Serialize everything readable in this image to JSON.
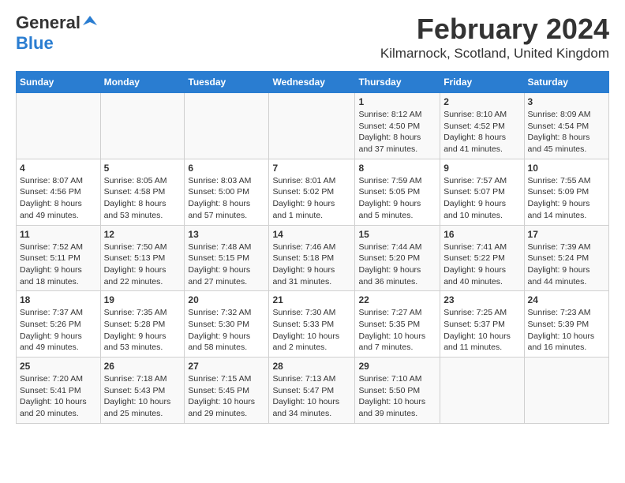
{
  "logo": {
    "general": "General",
    "blue": "Blue"
  },
  "title": "February 2024",
  "subtitle": "Kilmarnock, Scotland, United Kingdom",
  "headers": [
    "Sunday",
    "Monday",
    "Tuesday",
    "Wednesday",
    "Thursday",
    "Friday",
    "Saturday"
  ],
  "weeks": [
    [
      {
        "day": "",
        "info": ""
      },
      {
        "day": "",
        "info": ""
      },
      {
        "day": "",
        "info": ""
      },
      {
        "day": "",
        "info": ""
      },
      {
        "day": "1",
        "info": "Sunrise: 8:12 AM\nSunset: 4:50 PM\nDaylight: 8 hours\nand 37 minutes."
      },
      {
        "day": "2",
        "info": "Sunrise: 8:10 AM\nSunset: 4:52 PM\nDaylight: 8 hours\nand 41 minutes."
      },
      {
        "day": "3",
        "info": "Sunrise: 8:09 AM\nSunset: 4:54 PM\nDaylight: 8 hours\nand 45 minutes."
      }
    ],
    [
      {
        "day": "4",
        "info": "Sunrise: 8:07 AM\nSunset: 4:56 PM\nDaylight: 8 hours\nand 49 minutes."
      },
      {
        "day": "5",
        "info": "Sunrise: 8:05 AM\nSunset: 4:58 PM\nDaylight: 8 hours\nand 53 minutes."
      },
      {
        "day": "6",
        "info": "Sunrise: 8:03 AM\nSunset: 5:00 PM\nDaylight: 8 hours\nand 57 minutes."
      },
      {
        "day": "7",
        "info": "Sunrise: 8:01 AM\nSunset: 5:02 PM\nDaylight: 9 hours\nand 1 minute."
      },
      {
        "day": "8",
        "info": "Sunrise: 7:59 AM\nSunset: 5:05 PM\nDaylight: 9 hours\nand 5 minutes."
      },
      {
        "day": "9",
        "info": "Sunrise: 7:57 AM\nSunset: 5:07 PM\nDaylight: 9 hours\nand 10 minutes."
      },
      {
        "day": "10",
        "info": "Sunrise: 7:55 AM\nSunset: 5:09 PM\nDaylight: 9 hours\nand 14 minutes."
      }
    ],
    [
      {
        "day": "11",
        "info": "Sunrise: 7:52 AM\nSunset: 5:11 PM\nDaylight: 9 hours\nand 18 minutes."
      },
      {
        "day": "12",
        "info": "Sunrise: 7:50 AM\nSunset: 5:13 PM\nDaylight: 9 hours\nand 22 minutes."
      },
      {
        "day": "13",
        "info": "Sunrise: 7:48 AM\nSunset: 5:15 PM\nDaylight: 9 hours\nand 27 minutes."
      },
      {
        "day": "14",
        "info": "Sunrise: 7:46 AM\nSunset: 5:18 PM\nDaylight: 9 hours\nand 31 minutes."
      },
      {
        "day": "15",
        "info": "Sunrise: 7:44 AM\nSunset: 5:20 PM\nDaylight: 9 hours\nand 36 minutes."
      },
      {
        "day": "16",
        "info": "Sunrise: 7:41 AM\nSunset: 5:22 PM\nDaylight: 9 hours\nand 40 minutes."
      },
      {
        "day": "17",
        "info": "Sunrise: 7:39 AM\nSunset: 5:24 PM\nDaylight: 9 hours\nand 44 minutes."
      }
    ],
    [
      {
        "day": "18",
        "info": "Sunrise: 7:37 AM\nSunset: 5:26 PM\nDaylight: 9 hours\nand 49 minutes."
      },
      {
        "day": "19",
        "info": "Sunrise: 7:35 AM\nSunset: 5:28 PM\nDaylight: 9 hours\nand 53 minutes."
      },
      {
        "day": "20",
        "info": "Sunrise: 7:32 AM\nSunset: 5:30 PM\nDaylight: 9 hours\nand 58 minutes."
      },
      {
        "day": "21",
        "info": "Sunrise: 7:30 AM\nSunset: 5:33 PM\nDaylight: 10 hours\nand 2 minutes."
      },
      {
        "day": "22",
        "info": "Sunrise: 7:27 AM\nSunset: 5:35 PM\nDaylight: 10 hours\nand 7 minutes."
      },
      {
        "day": "23",
        "info": "Sunrise: 7:25 AM\nSunset: 5:37 PM\nDaylight: 10 hours\nand 11 minutes."
      },
      {
        "day": "24",
        "info": "Sunrise: 7:23 AM\nSunset: 5:39 PM\nDaylight: 10 hours\nand 16 minutes."
      }
    ],
    [
      {
        "day": "25",
        "info": "Sunrise: 7:20 AM\nSunset: 5:41 PM\nDaylight: 10 hours\nand 20 minutes."
      },
      {
        "day": "26",
        "info": "Sunrise: 7:18 AM\nSunset: 5:43 PM\nDaylight: 10 hours\nand 25 minutes."
      },
      {
        "day": "27",
        "info": "Sunrise: 7:15 AM\nSunset: 5:45 PM\nDaylight: 10 hours\nand 29 minutes."
      },
      {
        "day": "28",
        "info": "Sunrise: 7:13 AM\nSunset: 5:47 PM\nDaylight: 10 hours\nand 34 minutes."
      },
      {
        "day": "29",
        "info": "Sunrise: 7:10 AM\nSunset: 5:50 PM\nDaylight: 10 hours\nand 39 minutes."
      },
      {
        "day": "",
        "info": ""
      },
      {
        "day": "",
        "info": ""
      }
    ]
  ]
}
